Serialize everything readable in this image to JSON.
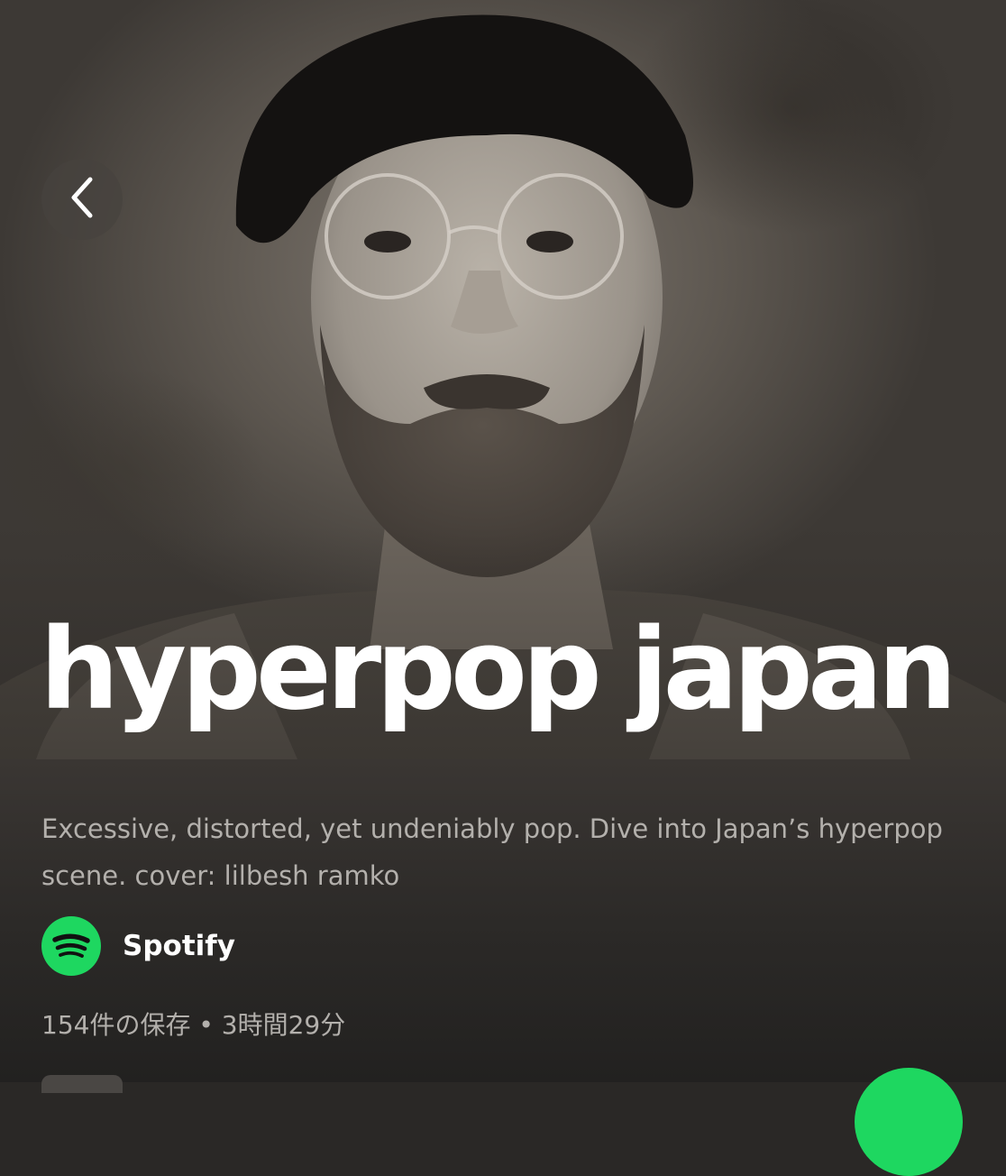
{
  "hero": {
    "cover_art": "grayscale portrait photo",
    "back_icon": "chevron-left-icon"
  },
  "playlist": {
    "title": "hyperpop japan",
    "description": "Excessive, distorted, yet undeniably pop. Dive into Japan’s hyperpop scene. cover: lilbesh ramko",
    "owner": {
      "name": "Spotify",
      "logo_icon": "spotify-logo-icon"
    },
    "meta": "154件の保存 • 3時間29分"
  },
  "colors": {
    "accent": "#1ed760",
    "background": "#2a2826",
    "text_primary": "#ffffff",
    "text_secondary": "#b3b0ac"
  }
}
